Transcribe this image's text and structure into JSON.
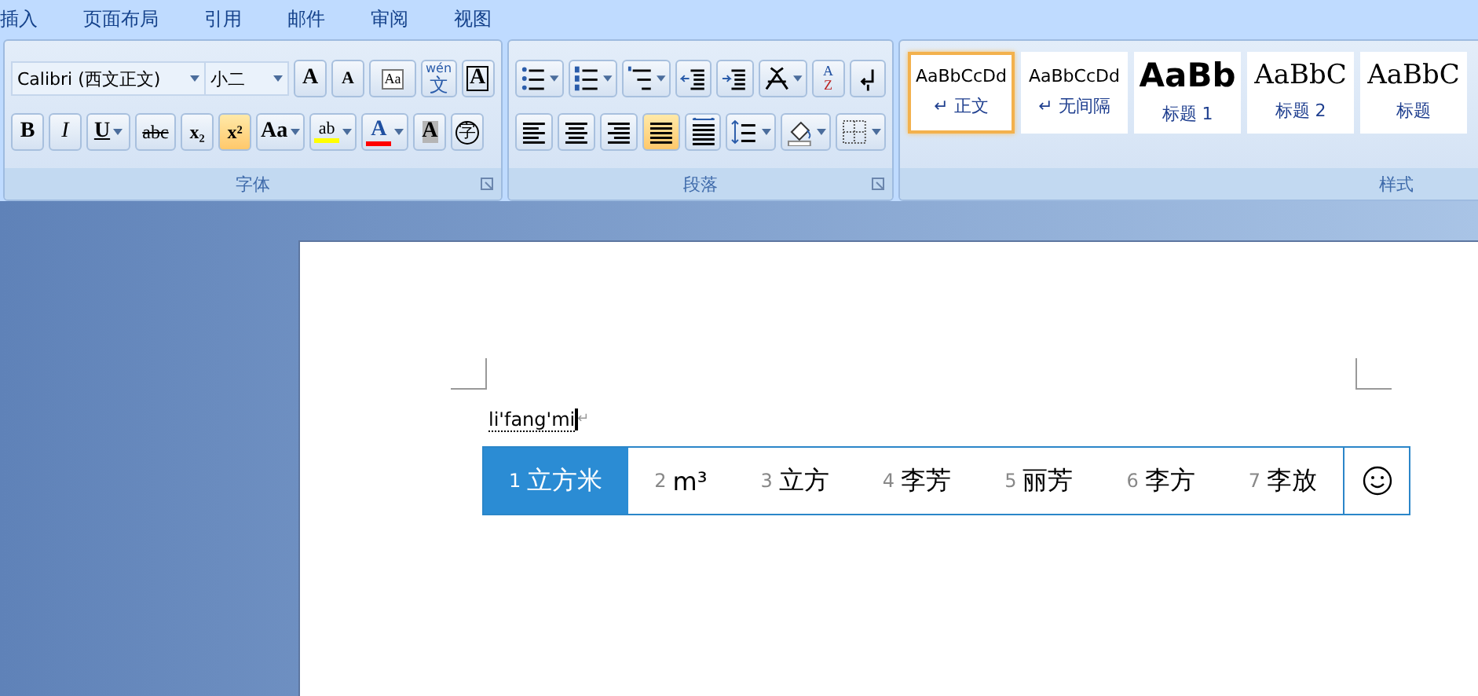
{
  "tabs": [
    {
      "label": "插入"
    },
    {
      "label": "页面布局"
    },
    {
      "label": "引用"
    },
    {
      "label": "邮件"
    },
    {
      "label": "审阅"
    },
    {
      "label": "视图"
    }
  ],
  "font_group": {
    "label": "字体",
    "font_name": "Calibri (西文正文)",
    "font_size": "小二",
    "row1": [
      {
        "kind": "grow",
        "text": "A",
        "active": false
      },
      {
        "kind": "shrink",
        "text": "A",
        "active": false
      },
      {
        "kind": "clear",
        "text": "Aa",
        "active": false
      },
      {
        "kind": "phonetic",
        "text": "wén",
        "sub": "文",
        "active": false
      },
      {
        "kind": "border",
        "text": "A",
        "active": false
      }
    ],
    "row2": [
      {
        "kind": "bold",
        "text": "B",
        "active": false
      },
      {
        "kind": "italic",
        "text": "I",
        "active": false
      },
      {
        "kind": "underline",
        "text": "U",
        "active": false
      },
      {
        "kind": "strike",
        "text": "abc",
        "active": false
      },
      {
        "kind": "sub",
        "text": "x₂",
        "active": false
      },
      {
        "kind": "sup",
        "text": "x²",
        "active": true
      },
      {
        "kind": "case",
        "text": "Aa",
        "active": false
      },
      {
        "kind": "highlight",
        "text": "ab",
        "active": false
      },
      {
        "kind": "color",
        "text": "A",
        "active": false
      },
      {
        "kind": "shade",
        "text": "A",
        "active": false
      },
      {
        "kind": "enclose",
        "text": "字",
        "active": false
      }
    ]
  },
  "paragraph_group": {
    "label": "段落",
    "row1": [
      {
        "kind": "bullets",
        "active": false
      },
      {
        "kind": "numbering",
        "active": false
      },
      {
        "kind": "multilevel",
        "active": false
      },
      {
        "kind": "outdent",
        "active": false
      },
      {
        "kind": "indent",
        "active": false
      },
      {
        "kind": "asian",
        "active": false
      },
      {
        "kind": "sort",
        "text": "A",
        "sub": "Z",
        "active": false
      },
      {
        "kind": "marks",
        "active": false
      }
    ],
    "row2": [
      {
        "kind": "left",
        "active": false
      },
      {
        "kind": "center",
        "active": false
      },
      {
        "kind": "right",
        "active": false
      },
      {
        "kind": "justify",
        "active": true
      },
      {
        "kind": "distribute",
        "active": false
      },
      {
        "kind": "spacing",
        "active": false
      },
      {
        "kind": "shading",
        "active": false
      },
      {
        "kind": "borders",
        "active": false
      }
    ]
  },
  "styles_group": {
    "label": "样式",
    "items": [
      {
        "kind": "normal",
        "sample": "AaBbCcDd",
        "mark": "↵",
        "label": "正文",
        "selected": true
      },
      {
        "kind": "normal",
        "sample": "AaBbCcDd",
        "mark": "↵",
        "label": "无间隔",
        "selected": false
      },
      {
        "kind": "heading1",
        "sample": "AaBb",
        "label": "标题 1",
        "selected": false
      },
      {
        "kind": "heading2",
        "sample": "AaBbC",
        "label": "标题 2",
        "selected": false
      },
      {
        "kind": "title",
        "sample": "AaBbC",
        "label": "标题",
        "selected": false
      }
    ]
  },
  "document": {
    "text": "li'fang'mi",
    "mark": "↵"
  },
  "candidates": [
    {
      "number": "1",
      "text": "立方米",
      "selected": true
    },
    {
      "number": "2",
      "text": "m³",
      "selected": false
    },
    {
      "number": "3",
      "text": "立方",
      "selected": false
    },
    {
      "number": "4",
      "text": "李芳",
      "selected": false
    },
    {
      "number": "5",
      "text": "丽芳",
      "selected": false
    },
    {
      "number": "6",
      "text": "李方",
      "selected": false
    },
    {
      "number": "7",
      "text": "李放",
      "selected": false
    }
  ]
}
